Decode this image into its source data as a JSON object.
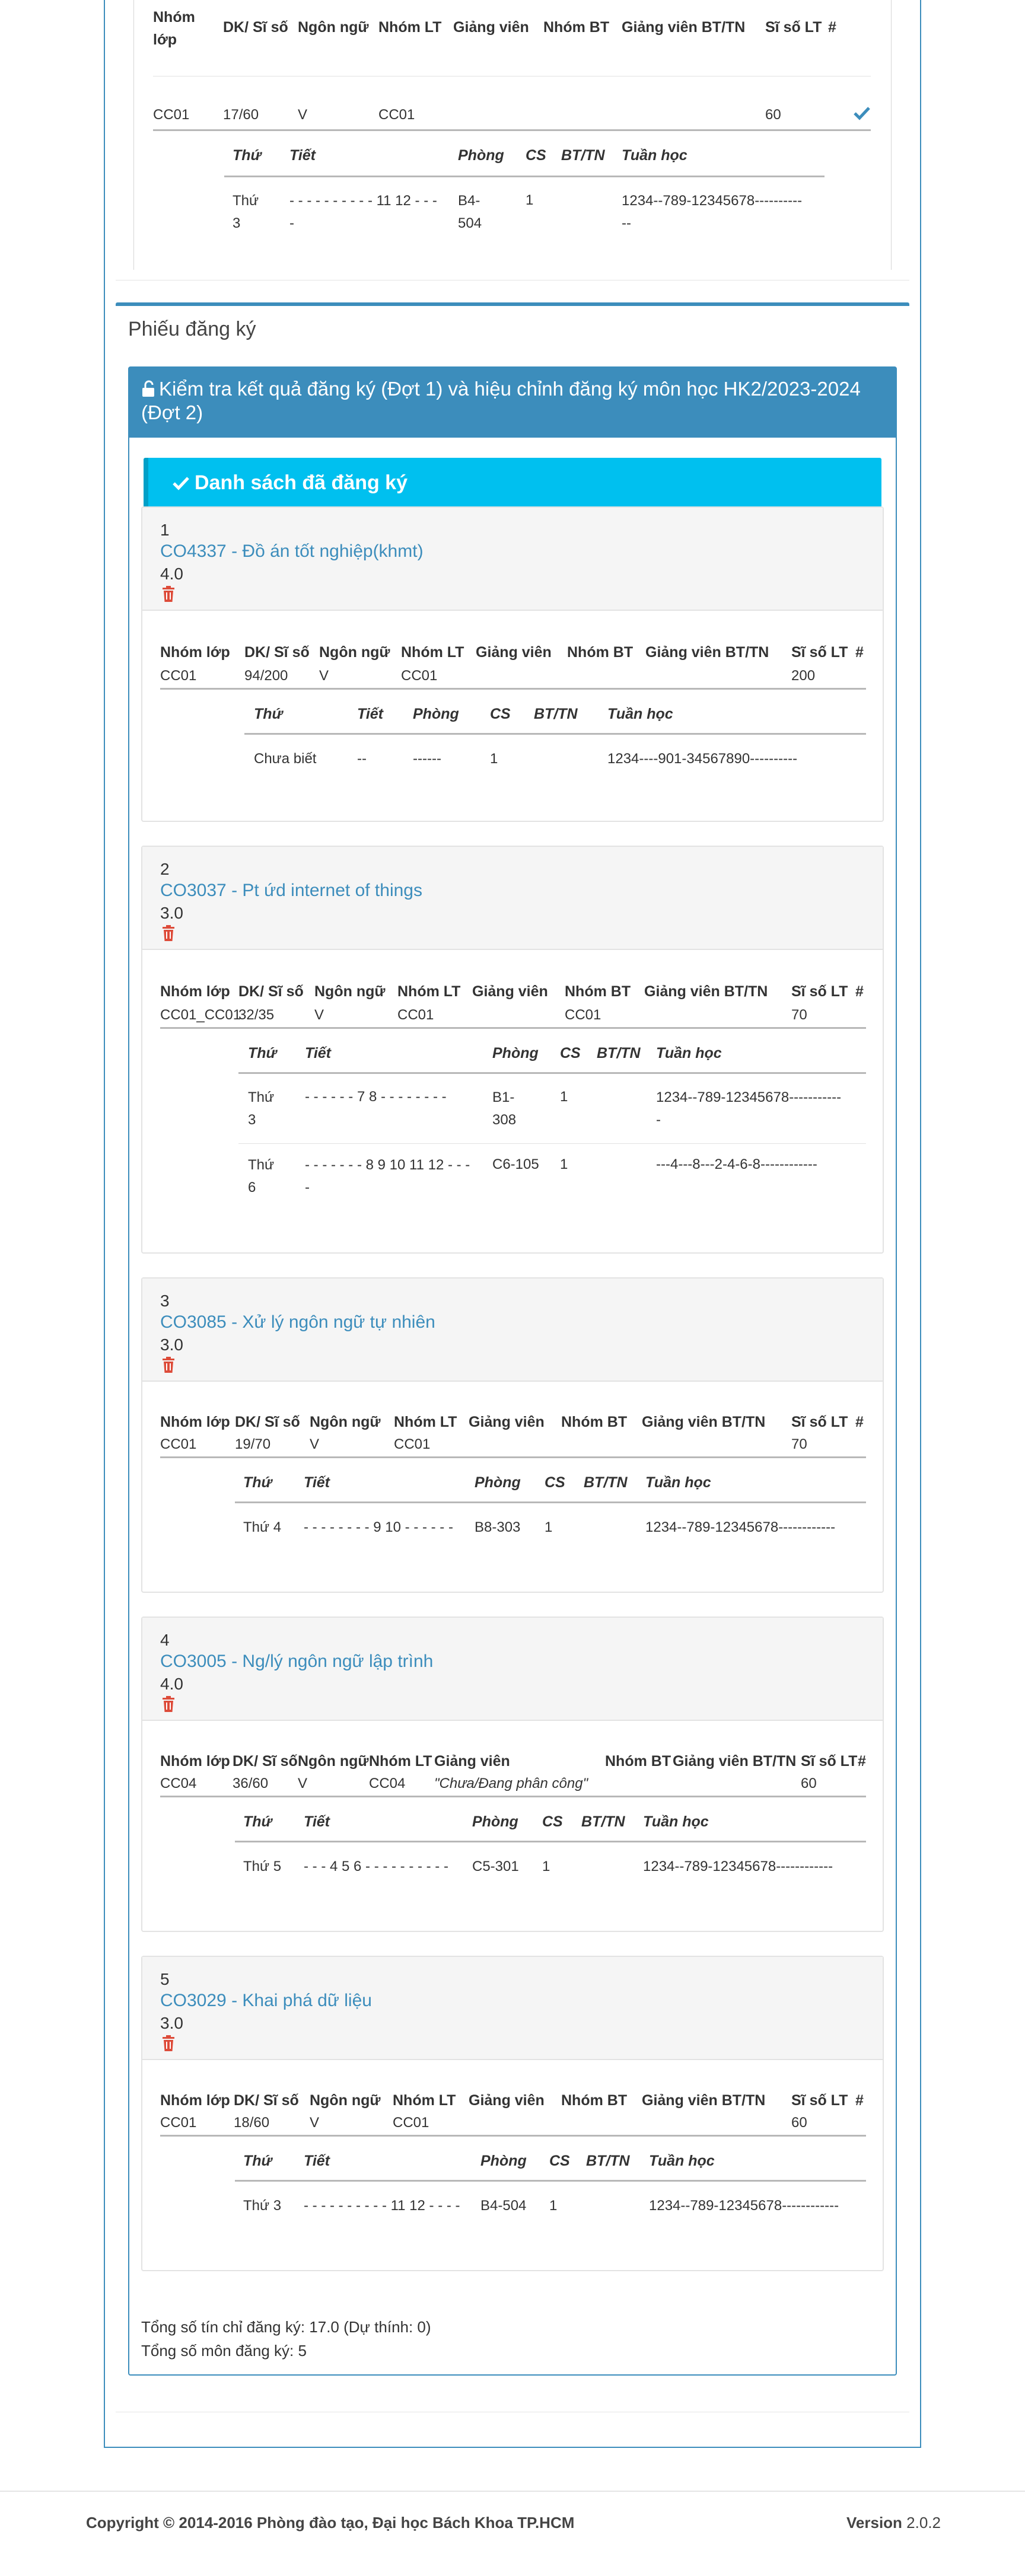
{
  "top": {
    "headers": [
      "Nhóm\nlớp",
      "DK/ Sĩ số",
      "Ngôn ngữ",
      "Nhóm LT",
      "Giảng viên",
      "Nhóm BT",
      "Giảng viên BT/TN",
      "Sĩ số LT",
      "#"
    ],
    "row": {
      "group": "CC01",
      "dk": "17/60",
      "lang": "V",
      "lt": "CC01",
      "size": "60"
    },
    "sub_headers": [
      "Thứ",
      "Tiết",
      "Phòng",
      "CS",
      "BT/TN",
      "Tuần học"
    ],
    "sub_row": {
      "day": "Thứ\n3",
      "period": "- - - - - - - - - - 11 12 - - -\n-",
      "room": "B4-\n504",
      "cs": "1",
      "weeks": "1234--789-12345678----------\n--"
    }
  },
  "register": {
    "title": "Phiếu đăng ký",
    "check_title": "Kiểm tra kết quả đăng ký (Đợt 1) và hiệu chỉnh đăng ký môn học HK2/2023-2024 (Đợt 2)",
    "list_title": "Danh sách đã đăng ký"
  },
  "col_headers": [
    "Nhóm lớp",
    "DK/ Sĩ số",
    "Ngôn ngữ",
    "Nhóm LT",
    "Giảng viên",
    "Nhóm BT",
    "Giảng viên BT/TN",
    "Sĩ số LT",
    "#"
  ],
  "sched_headers": [
    "Thứ",
    "Tiết",
    "Phòng",
    "CS",
    "BT/TN",
    "Tuần học"
  ],
  "courses": [
    {
      "num": "1",
      "name": "CO4337 - Đồ án tốt nghiệp(khmt)",
      "credits": "4.0",
      "row": {
        "group": "CC01",
        "dk": "94/200",
        "lang": "V",
        "lt": "CC01",
        "gv": "",
        "bt": "",
        "gvbt": "",
        "size": "200"
      },
      "sched": [
        {
          "day": "Chưa biết",
          "period": "--",
          "room": "------",
          "cs": "1",
          "weeks": "1234----901-34567890----------"
        }
      ]
    },
    {
      "num": "2",
      "name": "CO3037 - Pt ứd internet of things",
      "credits": "3.0",
      "row": {
        "group": "CC01_CC01",
        "dk": "32/35",
        "lang": "V",
        "lt": "CC01",
        "gv": "",
        "bt": "CC01",
        "gvbt": "",
        "size": "70"
      },
      "sched": [
        {
          "day": "Thứ\n3",
          "period": "- - - - - - 7 8 - - - - - - - -",
          "room": "B1-\n308",
          "cs": "1",
          "weeks": "1234--789-12345678-----------\n-"
        },
        {
          "day": "Thứ\n6",
          "period": "- - - - - - - 8 9 10 11 12 - - -\n-",
          "room": "C6-105",
          "cs": "1",
          "weeks": "---4---8---2-4-6-8------------"
        }
      ]
    },
    {
      "num": "3",
      "name": "CO3085 - Xử lý ngôn ngữ tự nhiên",
      "credits": "3.0",
      "row": {
        "group": "CC01",
        "dk": "19/70",
        "lang": "V",
        "lt": "CC01",
        "gv": "",
        "bt": "",
        "gvbt": "",
        "size": "70"
      },
      "sched": [
        {
          "day": "Thứ 4",
          "period": "- - - - - - - - 9 10 - - - - - -",
          "room": "B8-303",
          "cs": "1",
          "weeks": "1234--789-12345678------------"
        }
      ]
    },
    {
      "num": "4",
      "name": "CO3005 - Ng/lý ngôn ngữ lập trình",
      "credits": "4.0",
      "row": {
        "group": "CC04",
        "dk": "36/60",
        "lang": "V",
        "lt": "CC04",
        "gv": "\"Chưa/Đang phân công\"",
        "bt": "",
        "gvbt": "",
        "size": "60"
      },
      "sched": [
        {
          "day": "Thứ 5",
          "period": "- - - 4 5 6 - - - - - - - - - -",
          "room": "C5-301",
          "cs": "1",
          "weeks": "1234--789-12345678------------"
        }
      ]
    },
    {
      "num": "5",
      "name": "CO3029 - Khai phá dữ liệu",
      "credits": "3.0",
      "row": {
        "group": "CC01",
        "dk": "18/60",
        "lang": "V",
        "lt": "CC01",
        "gv": "",
        "bt": "",
        "gvbt": "",
        "size": "60"
      },
      "sched": [
        {
          "day": "Thứ 3",
          "period": "- - - - - - - - - - 11 12 - - - -",
          "room": "B4-504",
          "cs": "1",
          "weeks": "1234--789-12345678------------"
        }
      ]
    }
  ],
  "summary": {
    "credits": "Tổng số tín chỉ đăng ký: 17.0 (Dự thính: 0)",
    "subjects": "Tổng số môn đăng ký: 5"
  },
  "footer": {
    "copyright": "Copyright © 2014-2016 Phòng đào tạo, Đại học Bách Khoa TP.HCM",
    "version_label": "Version",
    "version_value": "2.0.2"
  },
  "colors": {
    "primary": "#3c8dbc",
    "info": "#00c0ef",
    "danger": "#dd4b39"
  },
  "icons": {
    "check": "check-icon",
    "lock": "unlock-icon",
    "list_check": "check-icon",
    "trash": "trash-icon"
  }
}
